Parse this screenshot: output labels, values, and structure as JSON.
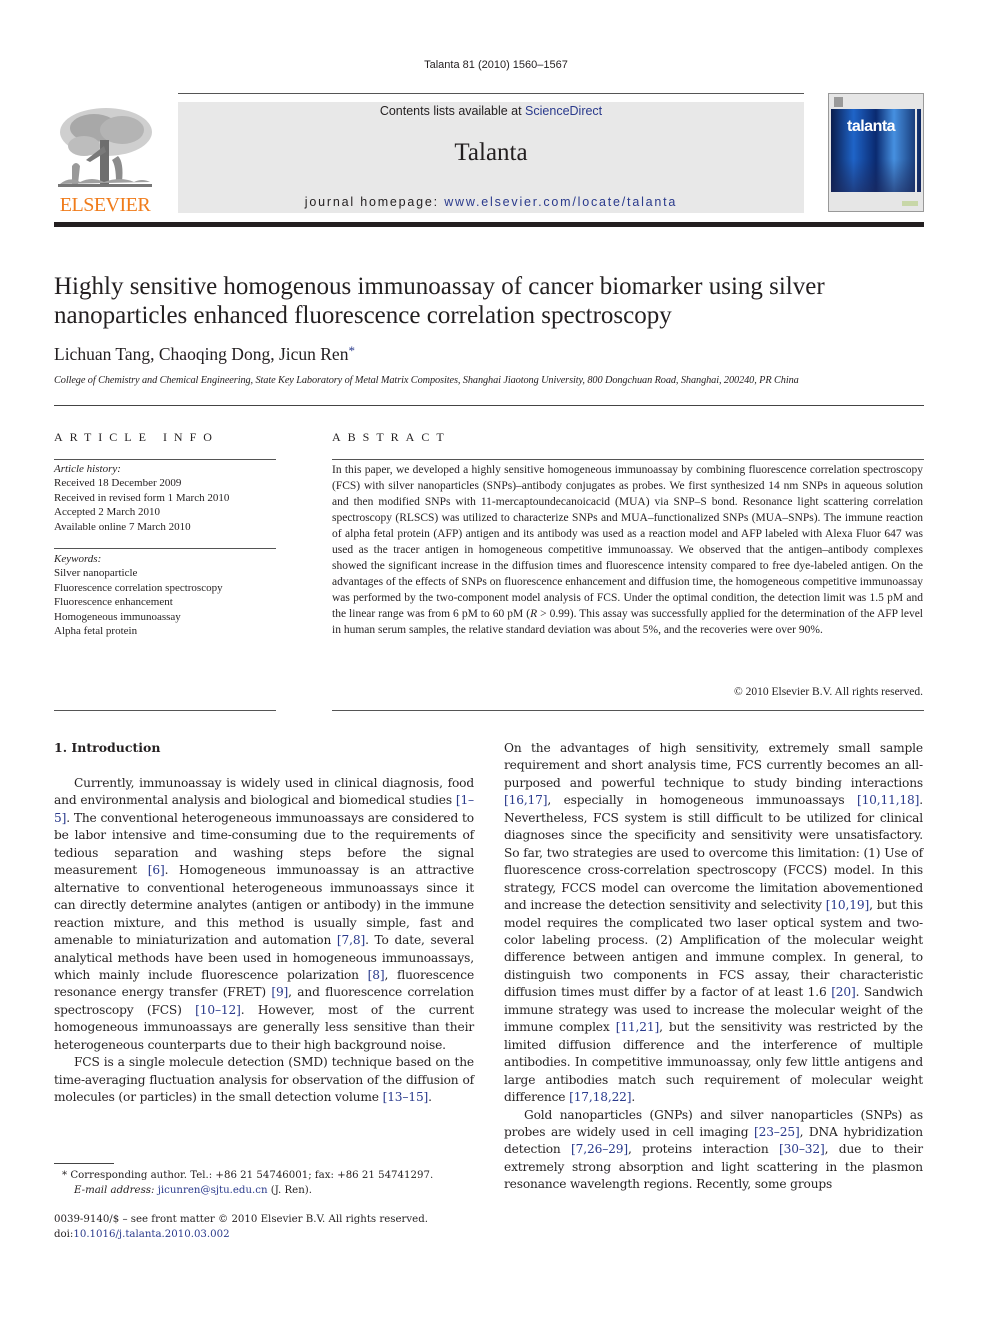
{
  "running_head": "Talanta 81 (2010) 1560–1567",
  "header": {
    "publisher_logo_text": "ELSEVIER",
    "contents_prefix": "Contents lists available at ",
    "contents_link": "ScienceDirect",
    "journal_title": "Talanta",
    "homepage_prefix": "journal homepage: ",
    "homepage_link": "www.elsevier.com/locate/talanta",
    "cover_title": "talanta",
    "colors": {
      "elsevier_orange": "#f07c1b",
      "link_blue": "#2a3a8c",
      "banner_gray": "#e8e8e8"
    }
  },
  "article": {
    "title": "Highly sensitive homogenous immunoassay of cancer biomarker using silver nanoparticles enhanced fluorescence correlation spectroscopy",
    "authors": "Lichuan Tang, Chaoqing Dong, Jicun Ren",
    "corresponding_mark": "*",
    "affiliation": "College of Chemistry and Chemical Engineering, State Key Laboratory of Metal Matrix Composites, Shanghai Jiaotong University, 800 Dongchuan Road, Shanghai, 200240, PR China"
  },
  "article_info": {
    "heading": "ARTICLE INFO",
    "history_label": "Article history:",
    "history": [
      "Received 18 December 2009",
      "Received in revised form 1 March 2010",
      "Accepted 2 March 2010",
      "Available online 7 March 2010"
    ],
    "keywords_label": "Keywords:",
    "keywords": [
      "Silver nanoparticle",
      "Fluorescence correlation spectroscopy",
      "Fluorescence enhancement",
      "Homogeneous immunoassay",
      "Alpha fetal protein"
    ]
  },
  "abstract": {
    "heading": "ABSTRACT",
    "text_1": "In this paper, we developed a highly sensitive homogeneous immunoassay by combining fluorescence correlation spectroscopy (FCS) with silver nanoparticles (SNPs)–antibody conjugates as probes. We first synthesized 14 nm SNPs in aqueous solution and then modified SNPs with 11-mercaptoundecanoicacid (MUA) via SNP–S bond. Resonance light scattering correlation spectroscopy (RLSCS) was utilized to characterize SNPs and MUA–functionalized SNPs (MUA–SNPs). The immune reaction of alpha fetal protein (AFP) antigen and its antibody was used as a reaction model and AFP labeled with Alexa Fluor 647 was used as the tracer antigen in homogeneous competitive immunoassay. We observed that the antigen–antibody complexes showed the significant increase in the diffusion times and fluorescence intensity compared to free dye-labeled antigen. On the advantages of the effects of SNPs on fluorescence enhancement and diffusion time, the homogeneous competitive immunoassay was performed by the two-component model analysis of FCS. Under the optimal condition, the detection limit was 1.5 pM and the linear range was from 6 pM to 60 pM (",
    "text_r": "R",
    "text_2": " > 0.99). This assay was successfully applied for the determination of the AFP level in human serum samples, the relative standard deviation was about 5%, and the recoveries were over 90%.",
    "copyright": "© 2010 Elsevier B.V. All rights reserved."
  },
  "body": {
    "section_heading": "1.  Introduction",
    "left_p1": [
      {
        "t": "Currently, immunoassay is widely used in clinical diagnosis, food and environmental analysis and biological and biomedical studies "
      },
      {
        "ref": "[1–5]"
      },
      {
        "t": ". The conventional heterogeneous immunoassays are considered to be labor intensive and time-consuming due to the requirements of tedious separation and washing steps before the signal measurement "
      },
      {
        "ref": "[6]"
      },
      {
        "t": ". Homogeneous immunoassay is an attractive alternative to conventional heterogeneous immunoassays since it can directly determine analytes (antigen or antibody) in the immune reaction mixture, and this method is usually simple, fast and amenable to miniaturization and automation "
      },
      {
        "ref": "[7,8]"
      },
      {
        "t": ". To date, several analytical methods have been used in homogeneous immunoassays, which mainly include fluorescence polarization "
      },
      {
        "ref": "[8]"
      },
      {
        "t": ", fluorescence resonance energy transfer (FRET) "
      },
      {
        "ref": "[9]"
      },
      {
        "t": ", and fluorescence correlation spectroscopy (FCS) "
      },
      {
        "ref": "[10–12]"
      },
      {
        "t": ". However, most of the current homogeneous immunoassays are generally less sensitive than their heterogeneous counterparts due to their high background noise."
      }
    ],
    "left_p2": [
      {
        "t": "FCS is a single molecule detection (SMD) technique based on the time-averaging fluctuation analysis for observation of the diffusion of molecules (or particles) in the small detection volume "
      },
      {
        "ref": "[13–15]"
      },
      {
        "t": "."
      }
    ],
    "right_p1": [
      {
        "t": "On the advantages of high sensitivity, extremely small sample requirement and short analysis time, FCS currently becomes an all-purposed and powerful technique to study binding interactions "
      },
      {
        "ref": "[16,17]"
      },
      {
        "t": ", especially in homogeneous immunoassays "
      },
      {
        "ref": "[10,11,18]"
      },
      {
        "t": ". Nevertheless, FCS system is still difficult to be utilized for clinical diagnoses since the specificity and sensitivity were unsatisfactory. So far, two strategies are used to overcome this limitation: (1) Use of fluorescence cross-correlation spectroscopy (FCCS) model. In this strategy, FCCS model can overcome the limitation abovementioned and increase the detection sensitivity and selectivity "
      },
      {
        "ref": "[10,19]"
      },
      {
        "t": ", but this model requires the complicated two laser optical system and two-color labeling process. (2) Amplification of the molecular weight difference between antigen and immune complex. In general, to distinguish two components in FCS assay, their characteristic diffusion times must differ by a factor of at least 1.6 "
      },
      {
        "ref": "[20]"
      },
      {
        "t": ". Sandwich immune strategy was used to increase the molecular weight of the immune complex "
      },
      {
        "ref": "[11,21]"
      },
      {
        "t": ", but the sensitivity was restricted by the limited diffusion difference and the interference of multiple antibodies. In competitive immunoassay, only few little antigens and large antibodies match such requirement of molecular weight difference "
      },
      {
        "ref": "[17,18,22]"
      },
      {
        "t": "."
      }
    ],
    "right_p2": [
      {
        "t": "Gold nanoparticles (GNPs) and silver nanoparticles (SNPs) as probes are widely used in cell imaging "
      },
      {
        "ref": "[23–25]"
      },
      {
        "t": ", DNA hybridization detection "
      },
      {
        "ref": "[7,26–29]"
      },
      {
        "t": ", proteins interaction "
      },
      {
        "ref": "[30–32]"
      },
      {
        "t": ", due to their extremely strong absorption and light scattering in the plasmon resonance wavelength regions. Recently, some groups"
      }
    ]
  },
  "footnote": {
    "mark": "*",
    "corresponding": "Corresponding author. Tel.: +86 21 54746001; fax: +86 21 54741297.",
    "email_label": "E-mail address:",
    "email": "jicunren@sjtu.edu.cn",
    "email_suffix": " (J. Ren)."
  },
  "front_matter": {
    "issn_line": "0039-9140/$ – see front matter © 2010 Elsevier B.V. All rights reserved.",
    "doi_prefix": "doi:",
    "doi": "10.1016/j.talanta.2010.03.002"
  }
}
